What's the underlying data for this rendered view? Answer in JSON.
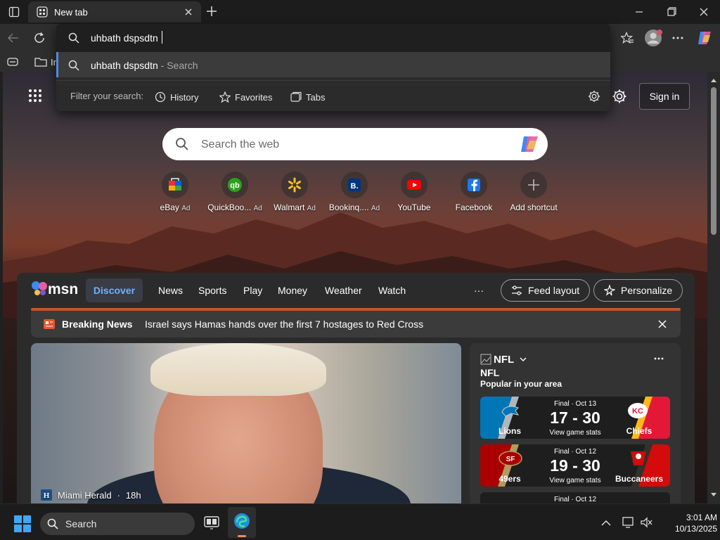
{
  "browser": {
    "tab_title": "New tab",
    "omnibox_value": "uhbath dspsdtn",
    "suggestion": {
      "query": "uhbath dspsdtn",
      "suffix": " - Search"
    },
    "filter_label": "Filter your search:",
    "filters": [
      "History",
      "Favorites",
      "Tabs"
    ],
    "favbar_partial": "In"
  },
  "page": {
    "signin": "Sign in",
    "search_placeholder": "Search the web",
    "shortcuts": [
      {
        "label": "eBay",
        "ad": "Ad"
      },
      {
        "label": "QuickBoo...",
        "ad": "Ad"
      },
      {
        "label": "Walmart",
        "ad": "Ad"
      },
      {
        "label": "Bookinq....",
        "ad": "Ad"
      },
      {
        "label": "YouTube",
        "ad": ""
      },
      {
        "label": "Facebook",
        "ad": ""
      },
      {
        "label": "Add shortcut",
        "ad": ""
      }
    ]
  },
  "msn": {
    "logo": "msn",
    "nav": [
      "Discover",
      "News",
      "Sports",
      "Play",
      "Money",
      "Weather",
      "Watch"
    ],
    "more": "···",
    "feed_layout": "Feed layout",
    "personalize": "Personalize",
    "breaking_title": "Breaking News",
    "breaking_text": "Israel says Hamas hands over the first 7 hostages to Red Cross",
    "hero_source": "Miami Herald",
    "hero_age": "18h",
    "nfl": {
      "header": "NFL",
      "title": "NFL",
      "subtitle": "Popular in your area",
      "games": [
        {
          "status": "Final · Oct 13",
          "score": "17 - 30",
          "stats": "View game stats",
          "home": "Lions",
          "away": "Chiefs"
        },
        {
          "status": "Final · Oct 12",
          "score": "19 - 30",
          "stats": "View game stats",
          "home": "49ers",
          "away": "Buccaneers"
        },
        {
          "status": "Final · Oct 12"
        }
      ]
    }
  },
  "taskbar": {
    "search": "Search",
    "time": "3:01 AM",
    "date": "10/13/2025"
  },
  "colors": {
    "accent": "#4c8dde",
    "msn_accent": "#6fb1ff",
    "breaking_bar": "#c5532e"
  }
}
